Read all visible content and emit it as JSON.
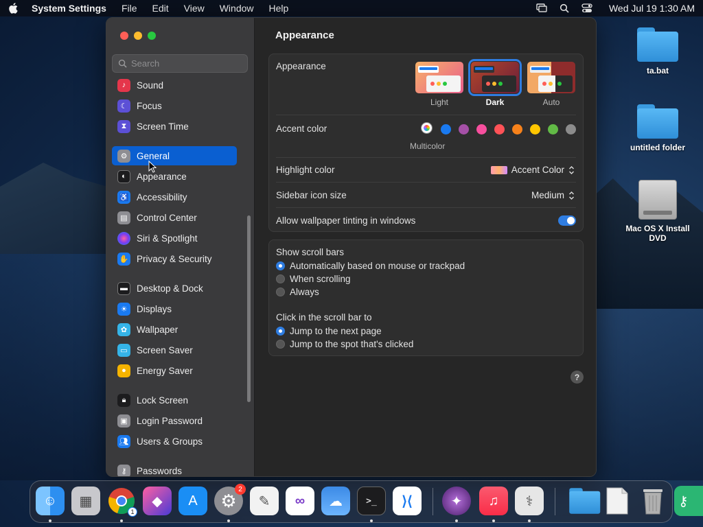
{
  "menubar": {
    "app": "System Settings",
    "items": [
      "File",
      "Edit",
      "View",
      "Window",
      "Help"
    ],
    "clock": "Wed Jul 19  1:30 AM"
  },
  "desktop": {
    "icons": [
      {
        "label": "ta.bat",
        "kind": "folder-icon"
      },
      {
        "label": "untitled folder",
        "kind": "folder-icon"
      },
      {
        "label": "Mac OS X Install DVD",
        "kind": "dvd-icon"
      }
    ]
  },
  "sidebar": {
    "search_placeholder": "Search",
    "items": [
      {
        "label": "Sound",
        "icon": "sound-icon",
        "color": "#e5364b"
      },
      {
        "label": "Focus",
        "icon": "moon-icon",
        "color": "#5c50d6"
      },
      {
        "label": "Screen Time",
        "icon": "hourglass-icon",
        "color": "#5c50d6"
      },
      {
        "label": "General",
        "icon": "gear-icon",
        "color": "#8e8e93",
        "active": true
      },
      {
        "label": "Appearance",
        "icon": "appearance-icon",
        "color": "#1c1c1e"
      },
      {
        "label": "Accessibility",
        "icon": "accessibility-icon",
        "color": "#1a7af0"
      },
      {
        "label": "Control Center",
        "icon": "control-center-icon",
        "color": "#8e8e93"
      },
      {
        "label": "Siri & Spotlight",
        "icon": "siri-icon",
        "color": "#b33fd6"
      },
      {
        "label": "Privacy & Security",
        "icon": "hand-icon",
        "color": "#1a7af0"
      },
      {
        "label": "Desktop & Dock",
        "icon": "dock-icon",
        "color": "#1c1c1e"
      },
      {
        "label": "Displays",
        "icon": "displays-icon",
        "color": "#1a7af0"
      },
      {
        "label": "Wallpaper",
        "icon": "wallpaper-icon",
        "color": "#35b4e8"
      },
      {
        "label": "Screen Saver",
        "icon": "screen-saver-icon",
        "color": "#35b4e8"
      },
      {
        "label": "Energy Saver",
        "icon": "bulb-icon",
        "color": "#f5b300"
      },
      {
        "label": "Lock Screen",
        "icon": "lock-icon",
        "color": "#1c1c1e"
      },
      {
        "label": "Login Password",
        "icon": "login-password-icon",
        "color": "#8e8e93"
      },
      {
        "label": "Users & Groups",
        "icon": "users-icon",
        "color": "#1a7af0"
      },
      {
        "label": "Passwords",
        "icon": "key-icon",
        "color": "#8e8e93"
      }
    ]
  },
  "main": {
    "title": "Appearance",
    "appearance": {
      "label": "Appearance",
      "options": [
        "Light",
        "Dark",
        "Auto"
      ],
      "selected": "Dark"
    },
    "accent": {
      "label": "Accent color",
      "multicolor_label": "Multicolor",
      "colors": [
        "#1a7af0",
        "#a550a7",
        "#f74f9e",
        "#ff5257",
        "#f7821b",
        "#ffc600",
        "#62ba46",
        "#8c8c8c"
      ]
    },
    "highlight": {
      "label": "Highlight color",
      "value": "Accent Color"
    },
    "sidebar_icon_size": {
      "label": "Sidebar icon size",
      "value": "Medium"
    },
    "wallpaper_tinting": {
      "label": "Allow wallpaper tinting in windows",
      "on": true
    },
    "scroll_bars": {
      "label": "Show scroll bars",
      "options": [
        "Automatically based on mouse or trackpad",
        "When scrolling",
        "Always"
      ],
      "selected": 0
    },
    "click_scroll": {
      "label": "Click in the scroll bar to",
      "options": [
        "Jump to the next page",
        "Jump to the spot that's clicked"
      ],
      "selected": 0
    },
    "help": "?"
  },
  "dock": {
    "apps": [
      {
        "name": "Finder",
        "color": "#2d8ff0"
      },
      {
        "name": "Launchpad",
        "color": "#c8c8cc"
      },
      {
        "name": "Chrome",
        "color": "#ffffff",
        "sub_badge": "1"
      },
      {
        "name": "Shortcuts",
        "color": "#4a3bd6"
      },
      {
        "name": "App Store",
        "color": "#1a8ef5"
      },
      {
        "name": "System Settings",
        "color": "#8e8e93",
        "badge": "2"
      },
      {
        "name": "TextEdit",
        "color": "#f2f2f2"
      },
      {
        "name": "Visual Studio",
        "color": "#ffffff"
      },
      {
        "name": "Weather",
        "color": "#3c8ae6"
      },
      {
        "name": "Terminal",
        "color": "#1c1c1e"
      },
      {
        "name": "VS Code",
        "color": "#ffffff"
      },
      {
        "name": "Tor Browser",
        "color": "#6a2f8f"
      },
      {
        "name": "Music",
        "color": "#fa3e55"
      },
      {
        "name": "Disk Utility",
        "color": "#e6e6e6"
      },
      {
        "name": "Folder",
        "color": "#3a9be0"
      },
      {
        "name": "Document",
        "color": "#f2f2f2"
      },
      {
        "name": "Trash",
        "color": "#b0b0b0"
      }
    ]
  }
}
